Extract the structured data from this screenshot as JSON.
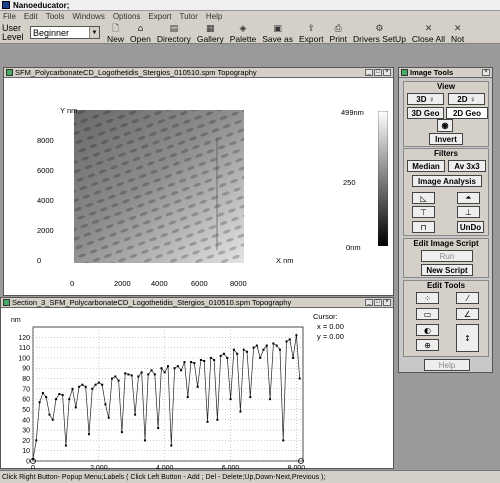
{
  "app": {
    "title": "Nanoeducator;"
  },
  "menu": [
    "File",
    "Edit",
    "Tools",
    "Windows",
    "Options",
    "Export",
    "Tutor",
    "Help"
  ],
  "toolbar": {
    "user_level_label": "User Level",
    "level_value": "Beginner",
    "buttons": [
      {
        "label": "New",
        "icon": "new-icon"
      },
      {
        "label": "Open",
        "icon": "open-icon"
      },
      {
        "label": "Directory",
        "icon": "directory-icon"
      },
      {
        "label": "Gallery",
        "icon": "gallery-icon"
      },
      {
        "label": "Palette",
        "icon": "palette-icon"
      },
      {
        "label": "Save as",
        "icon": "save-icon"
      },
      {
        "label": "Export",
        "icon": "export-icon"
      },
      {
        "label": "Print",
        "icon": "print-icon"
      },
      {
        "label": "Drivers SetUp",
        "icon": "drivers-icon"
      },
      {
        "label": "Close All",
        "icon": "close-all-icon"
      },
      {
        "label": "Not",
        "icon": "not-icon"
      }
    ]
  },
  "topo_window": {
    "title": "SFM_PolycarbonateCD_Logothetidis_Stergios_010510.spm  Topography",
    "y_axis_label": "Y nm",
    "x_axis_label": "X nm",
    "y_ticks": [
      "8000",
      "6000",
      "4000",
      "2000",
      "0"
    ],
    "x_ticks": [
      "0",
      "2000",
      "4000",
      "6000",
      "8000"
    ],
    "scale_labels": [
      "499nm",
      "250",
      "0nm"
    ]
  },
  "section_window": {
    "title": "Section_3_SFM_PolycarbonateCD_Logothetidis_Stergios_010510.spm  Topography",
    "cursor_label": "Cursor:",
    "cursor_x": "x = 0.00",
    "cursor_y": "y = 0.00"
  },
  "image_tools": {
    "title": "Image Tools",
    "view_header": "View",
    "view_buttons": [
      "3D",
      "2D",
      "3D Geo",
      "2D Geo"
    ],
    "invert": "Invert",
    "filters_header": "Filters",
    "median": "Median",
    "av": "Av 3x3",
    "image_analysis": "Image Analysis",
    "undo": "UnDo",
    "script_header": "Edit Image Script",
    "run": "Run",
    "new_script": "New Script",
    "edit_tools_header": "Edit Tools",
    "help": "Help"
  },
  "status": "Click Right Button- Popup Menu;Labels ( Click  Left Button - Add ;  Del - Delete;Up,Down-Next,Previous );",
  "chart_data": {
    "type": "line",
    "ylabel": "nm",
    "xlabel": "nm",
    "xlim": [
      0,
      8200
    ],
    "ylim": [
      0,
      130
    ],
    "y_ticks": [
      0,
      10,
      20,
      30,
      40,
      50,
      60,
      70,
      80,
      90,
      100,
      110,
      120
    ],
    "x_ticks": [
      "0",
      "2,000",
      "4,000",
      "6,000",
      "8,000"
    ],
    "x_tick_values": [
      0,
      2000,
      4000,
      6000,
      8000
    ],
    "grid": true,
    "x": [
      0,
      100,
      200,
      300,
      400,
      500,
      600,
      700,
      800,
      900,
      1000,
      1100,
      1200,
      1300,
      1400,
      1500,
      1600,
      1700,
      1800,
      1900,
      2000,
      2100,
      2200,
      2300,
      2400,
      2500,
      2600,
      2700,
      2800,
      2900,
      3000,
      3100,
      3200,
      3300,
      3400,
      3500,
      3600,
      3700,
      3800,
      3900,
      4000,
      4100,
      4200,
      4300,
      4400,
      4500,
      4600,
      4700,
      4800,
      4900,
      5000,
      5100,
      5200,
      5300,
      5400,
      5500,
      5600,
      5700,
      5800,
      5900,
      6000,
      6100,
      6200,
      6300,
      6400,
      6500,
      6600,
      6700,
      6800,
      6900,
      7000,
      7100,
      7200,
      7300,
      7400,
      7500,
      7600,
      7700,
      7800,
      7900,
      8000,
      8100
    ],
    "values": [
      2,
      20,
      57,
      66,
      62,
      45,
      40,
      60,
      65,
      64,
      15,
      60,
      70,
      52,
      72,
      74,
      72,
      26,
      70,
      74,
      76,
      74,
      55,
      42,
      80,
      82,
      78,
      28,
      85,
      84,
      83,
      45,
      82,
      86,
      20,
      84,
      88,
      84,
      32,
      90,
      86,
      92,
      15,
      90,
      92,
      88,
      96,
      62,
      96,
      95,
      72,
      98,
      97,
      38,
      100,
      98,
      40,
      102,
      104,
      100,
      60,
      108,
      104,
      48,
      108,
      106,
      62,
      110,
      112,
      100,
      108,
      112,
      60,
      114,
      112,
      108,
      20,
      116,
      118,
      100,
      122,
      80
    ]
  }
}
